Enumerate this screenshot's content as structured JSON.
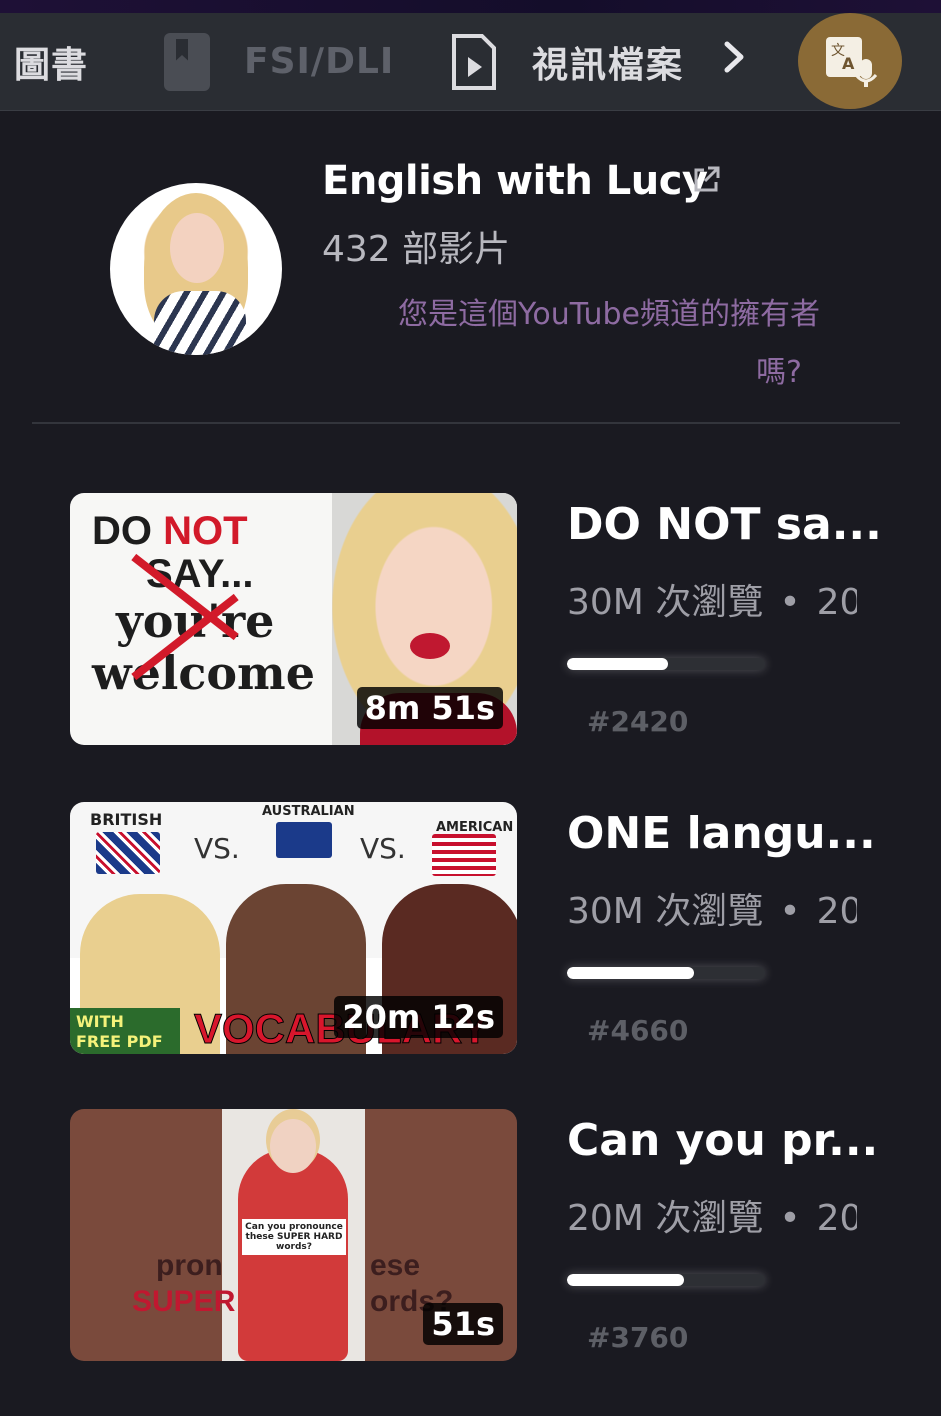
{
  "topbar": {
    "tabs": [
      {
        "label": "圖書",
        "icon": "",
        "state": "active"
      },
      {
        "label": "FSI/DLI",
        "icon": "book-icon",
        "state": "disabled"
      },
      {
        "label": "視訊檔案",
        "icon": "video-file-icon",
        "state": "active"
      }
    ],
    "next_icon": "chevron-right-icon",
    "translate_icon": "translate-mic-icon",
    "translate_bg": "#8a6a36"
  },
  "channel": {
    "name": "English with Lucy",
    "link_icon": "external-link-icon",
    "video_count": "432 部影片",
    "owner_question_line1": "您是這個YouTube頻道的擁有者",
    "owner_question_line2": "嗎?",
    "owner_question_color": "#8e6ba2"
  },
  "videos": [
    {
      "title": "DO NOT sa...",
      "views": "30M 次瀏覽",
      "sep": "•",
      "year": "20",
      "duration": "8m 51s",
      "progress": 0.51,
      "rank": "#2420",
      "thumb_text": {
        "line1a": "DO ",
        "line1b": "NOT",
        "line2": "SAY...",
        "line3": "you're",
        "line4": "welcome"
      }
    },
    {
      "title": "ONE langu...",
      "views": "30M 次瀏覽",
      "sep": "•",
      "year": "20",
      "duration": "20m 12s",
      "progress": 0.64,
      "rank": "#4660",
      "thumb_text": {
        "british": "BRITISH",
        "vs1": "VS.",
        "australian": "AUSTRALIAN",
        "vs2": "VS.",
        "american": "AMERICAN",
        "pdf": "WITH FREE PDF",
        "band": "VOCABULARY"
      }
    },
    {
      "title": "Can you pr...",
      "views": "20M 次瀏覽",
      "sep": "•",
      "year": "20",
      "duration": "51s",
      "progress": 0.59,
      "rank": "#3760",
      "thumb_text": {
        "left1": "pron",
        "left2": "SUPER",
        "right1": "ese",
        "right2": "ords?",
        "sign": "Can you pronounce these SUPER HARD words?"
      }
    }
  ]
}
